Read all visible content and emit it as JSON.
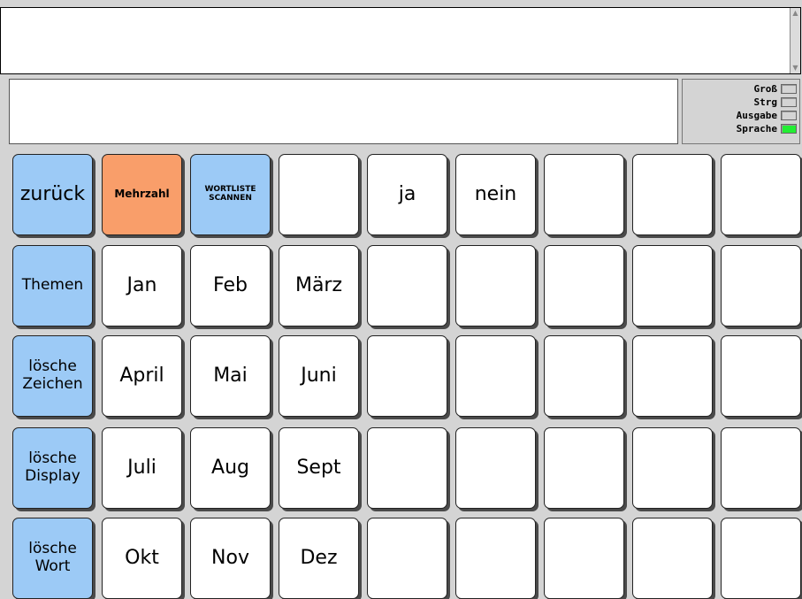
{
  "status": [
    {
      "label": "Groß",
      "on": false
    },
    {
      "label": "Strg",
      "on": false
    },
    {
      "label": "Ausgabe",
      "on": false
    },
    {
      "label": "Sprache",
      "on": true
    }
  ],
  "colors": {
    "blue": "#9ccaf6",
    "orange": "#f99e6a",
    "led_on": "#22ee33"
  },
  "grid": {
    "rows": [
      [
        {
          "label": "zurück",
          "color": "blue",
          "name": "back-button"
        },
        {
          "label": "Mehrzahl",
          "color": "orange",
          "size": "small",
          "name": "plural-button"
        },
        {
          "label": "WORTLISTE\nSCANNEN",
          "color": "blue",
          "size": "tiny",
          "name": "scan-wordlist-button"
        },
        {
          "label": "",
          "name": "empty-cell"
        },
        {
          "label": "ja",
          "name": "yes-button"
        },
        {
          "label": "nein",
          "name": "no-button"
        },
        {
          "label": "",
          "name": "empty-cell"
        },
        {
          "label": "",
          "name": "empty-cell"
        },
        {
          "label": "",
          "name": "empty-cell"
        }
      ],
      [
        {
          "label": "Themen",
          "color": "blue",
          "size": "mid",
          "name": "topics-button"
        },
        {
          "label": "Jan",
          "name": "month-jan-button"
        },
        {
          "label": "Feb",
          "name": "month-feb-button"
        },
        {
          "label": "März",
          "name": "month-mar-button"
        },
        {
          "label": "",
          "name": "empty-cell"
        },
        {
          "label": "",
          "name": "empty-cell"
        },
        {
          "label": "",
          "name": "empty-cell"
        },
        {
          "label": "",
          "name": "empty-cell"
        },
        {
          "label": "",
          "name": "empty-cell"
        }
      ],
      [
        {
          "label": "lösche\nZeichen",
          "color": "blue",
          "size": "mid",
          "name": "delete-char-button"
        },
        {
          "label": "April",
          "name": "month-apr-button"
        },
        {
          "label": "Mai",
          "name": "month-may-button"
        },
        {
          "label": "Juni",
          "name": "month-jun-button"
        },
        {
          "label": "",
          "name": "empty-cell"
        },
        {
          "label": "",
          "name": "empty-cell"
        },
        {
          "label": "",
          "name": "empty-cell"
        },
        {
          "label": "",
          "name": "empty-cell"
        },
        {
          "label": "",
          "name": "empty-cell"
        }
      ],
      [
        {
          "label": "lösche\nDisplay",
          "color": "blue",
          "size": "mid",
          "name": "delete-display-button"
        },
        {
          "label": "Juli",
          "name": "month-jul-button"
        },
        {
          "label": "Aug",
          "name": "month-aug-button"
        },
        {
          "label": "Sept",
          "name": "month-sep-button"
        },
        {
          "label": "",
          "name": "empty-cell"
        },
        {
          "label": "",
          "name": "empty-cell"
        },
        {
          "label": "",
          "name": "empty-cell"
        },
        {
          "label": "",
          "name": "empty-cell"
        },
        {
          "label": "",
          "name": "empty-cell"
        }
      ],
      [
        {
          "label": "lösche\nWort",
          "color": "blue",
          "size": "mid",
          "name": "delete-word-button"
        },
        {
          "label": "Okt",
          "name": "month-oct-button"
        },
        {
          "label": "Nov",
          "name": "month-nov-button"
        },
        {
          "label": "Dez",
          "name": "month-dec-button"
        },
        {
          "label": "",
          "name": "empty-cell"
        },
        {
          "label": "",
          "name": "empty-cell"
        },
        {
          "label": "",
          "name": "empty-cell"
        },
        {
          "label": "",
          "name": "empty-cell"
        },
        {
          "label": "",
          "name": "empty-cell"
        }
      ]
    ]
  }
}
